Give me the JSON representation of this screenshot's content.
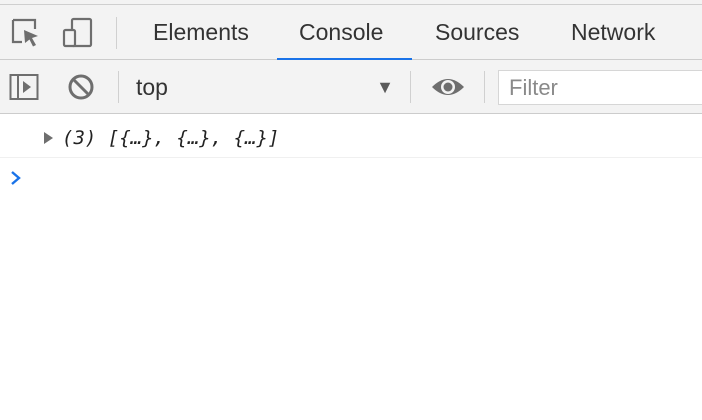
{
  "tabs": [
    {
      "label": "Elements",
      "active": false
    },
    {
      "label": "Console",
      "active": true
    },
    {
      "label": "Sources",
      "active": false
    },
    {
      "label": "Network",
      "active": false
    }
  ],
  "toolbar": {
    "context": "top",
    "filter_placeholder": "Filter",
    "filter_value": ""
  },
  "console": {
    "entries": [
      {
        "text": "(3) [{…}, {…}, {…}]",
        "expandable": true
      }
    ]
  },
  "icons": {
    "inspect": "inspect-element-icon",
    "device": "device-toolbar-icon",
    "sidebar": "sidebar-toggle-icon",
    "clear": "clear-console-icon",
    "eye": "live-expression-icon",
    "prompt": "prompt-chevron-icon"
  },
  "colors": {
    "accent": "#1a73e8",
    "toolbar_bg": "#f3f3f3",
    "prompt": "#1a73e8"
  }
}
